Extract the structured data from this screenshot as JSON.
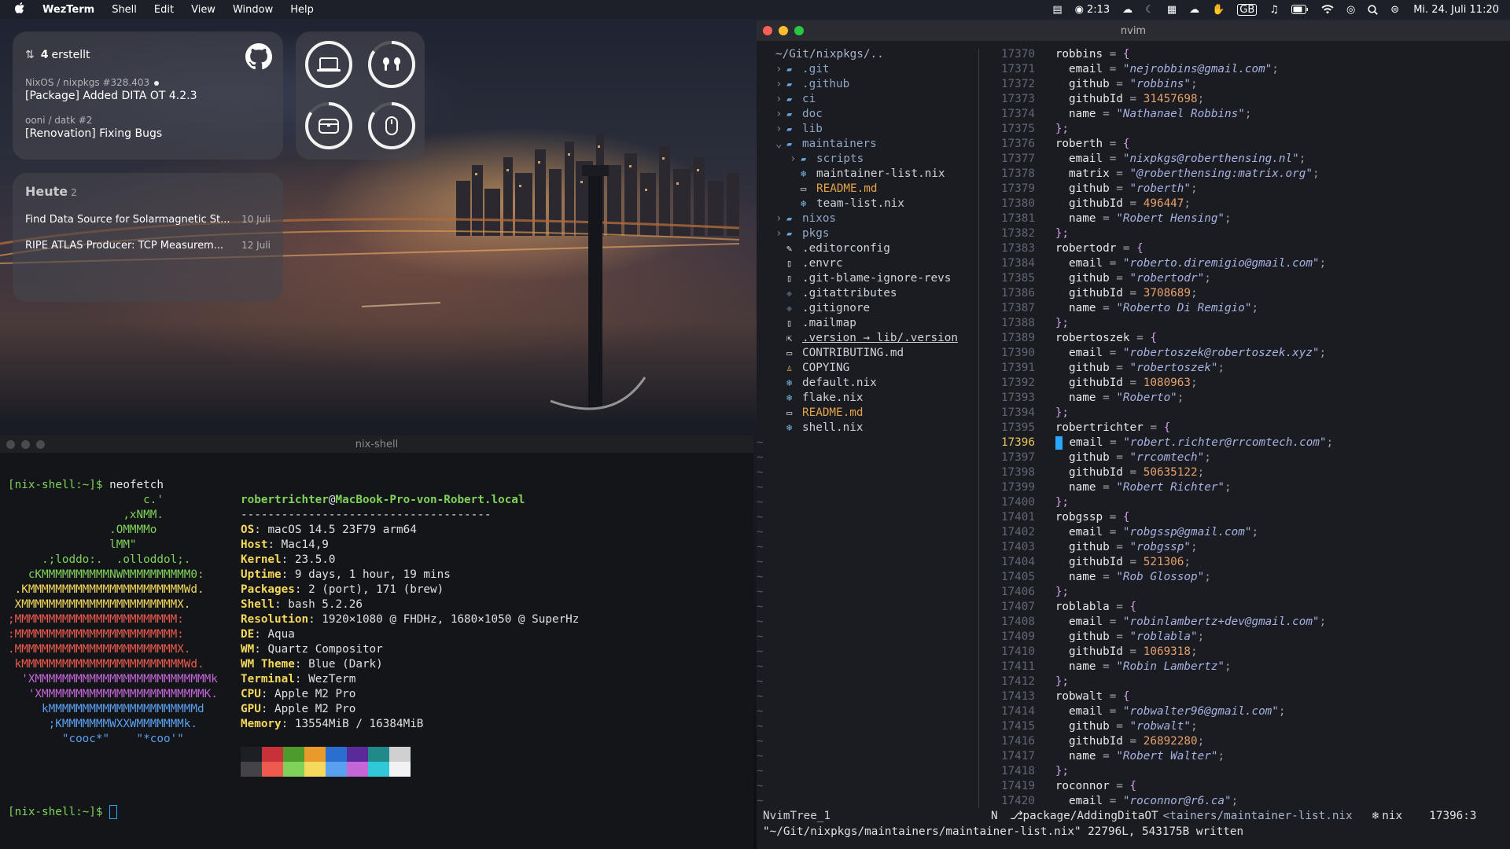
{
  "menubar": {
    "app_name": "WezTerm",
    "menus": [
      "Shell",
      "Edit",
      "View",
      "Window",
      "Help"
    ],
    "timer": "2:13",
    "keyboard": "GB",
    "datetime": "Mi. 24. Juli  11:20"
  },
  "github_widget": {
    "count": "4",
    "label": "erstellt",
    "items": [
      {
        "meta": "NixOS / nixpkgs #328.403",
        "title": "[Package] Added DITA OT 4.2.3",
        "unread": true
      },
      {
        "meta": "ooni / datk #2",
        "title": "[Renovation] Fixing Bugs",
        "unread": false
      }
    ]
  },
  "battery_widget": {
    "devices": [
      {
        "icon": "laptop-icon",
        "level": 1.0
      },
      {
        "icon": "airpods-icon",
        "level": 0.85
      },
      {
        "icon": "airpods-case-icon",
        "level": 0.85
      },
      {
        "icon": "mouse-icon",
        "level": 0.85
      }
    ]
  },
  "today_widget": {
    "title": "Heute",
    "count": "2",
    "items": [
      {
        "text": "Find Data Source for Solarmagnetic St...",
        "date": "10 Juli"
      },
      {
        "text": "RIPE ATLAS Producer: TCP Measurem...",
        "date": "12 Juli"
      }
    ]
  },
  "nixshell": {
    "title": "nix-shell",
    "prompt": "[nix-shell:~]$",
    "command": "neofetch",
    "user_host_user": "robertrichter",
    "user_host_at": "@",
    "user_host_host": "MacBook-Pro-von-Robert.local",
    "separator": "-------------------------------------",
    "art": [
      "                    c.'",
      "                 ,xNMM.",
      "               .OMMMMo",
      "               lMM\"",
      "     .;loddo:.  .olloddol;.",
      "   cKMMMMMMMMMMNWMMMMMMMMMM0:",
      " .KMMMMMMMMMMMMMMMMMMMMMMMWd.",
      " XMMMMMMMMMMMMMMMMMMMMMMMX.",
      ";MMMMMMMMMMMMMMMMMMMMMMMM:",
      ":MMMMMMMMMMMMMMMMMMMMMMMM:",
      ".MMMMMMMMMMMMMMMMMMMMMMMMX.",
      " kMMMMMMMMMMMMMMMMMMMMMMMMWd.",
      "  'XMMMMMMMMMMMMMMMMMMMMMMMMMMk",
      "   'XMMMMMMMMMMMMMMMMMMMMMMMMK.",
      "     kMMMMMMMMMMMMMMMMMMMMMMd",
      "      ;KMMMMMMMWXXWMMMMMMMk.",
      "        \"cooc*\"    \"*coo'\""
    ],
    "art_colors": [
      "#7fd35a",
      "#7fd35a",
      "#7fd35a",
      "#7fd35a",
      "#7fd35a",
      "#7fd35a",
      "#f5d95c",
      "#f5d95c",
      "#ef5a4e",
      "#ef5a4e",
      "#ef5a4e",
      "#ef5a4e",
      "#c466d8",
      "#c466d8",
      "#5aa0f0",
      "#5aa0f0",
      "#5aa0f0"
    ],
    "info": [
      {
        "key": "OS",
        "value": "macOS 14.5 23F79 arm64"
      },
      {
        "key": "Host",
        "value": "Mac14,9"
      },
      {
        "key": "Kernel",
        "value": "23.5.0"
      },
      {
        "key": "Uptime",
        "value": "9 days, 1 hour, 19 mins"
      },
      {
        "key": "Packages",
        "value": "2 (port), 171 (brew)"
      },
      {
        "key": "Shell",
        "value": "bash 5.2.26"
      },
      {
        "key": "Resolution",
        "value": "1920×1080 @ FHDHz, 1680×1050 @ SuperHz"
      },
      {
        "key": "DE",
        "value": "Aqua"
      },
      {
        "key": "WM",
        "value": "Quartz Compositor"
      },
      {
        "key": "WM Theme",
        "value": "Blue (Dark)"
      },
      {
        "key": "Terminal",
        "value": "WezTerm"
      },
      {
        "key": "CPU",
        "value": "Apple M2 Pro"
      },
      {
        "key": "GPU",
        "value": "Apple M2 Pro"
      },
      {
        "key": "Memory",
        "value": "13554MiB / 16384MiB"
      }
    ],
    "palette_top": [
      "#1e1f24",
      "#c8303a",
      "#4f9a2d",
      "#e89a2a",
      "#2a6fd0",
      "#5a2a9a",
      "#208a8a",
      "#d0d0d0"
    ],
    "palette_bottom": [
      "#444448",
      "#ef5a4e",
      "#7fd35a",
      "#f5d95c",
      "#5aa0f0",
      "#c466d8",
      "#30c8d8",
      "#f2f2f2"
    ]
  },
  "nvim": {
    "title": "nvim",
    "tree_root": "~/Git/nixpkgs/..",
    "tree": [
      {
        "depth": 0,
        "chev": "›",
        "icon": "folder-icon",
        "name": ".git",
        "kind": "dir"
      },
      {
        "depth": 0,
        "chev": "›",
        "icon": "folder-icon",
        "name": ".github",
        "kind": "dir"
      },
      {
        "depth": 0,
        "chev": "›",
        "icon": "folder-icon",
        "name": "ci",
        "kind": "dir"
      },
      {
        "depth": 0,
        "chev": "›",
        "icon": "folder-icon",
        "name": "doc",
        "kind": "dir"
      },
      {
        "depth": 0,
        "chev": "›",
        "icon": "folder-icon",
        "name": "lib",
        "kind": "dir"
      },
      {
        "depth": 0,
        "chev": "⌄",
        "icon": "folder-open-icon",
        "name": "maintainers",
        "kind": "dir"
      },
      {
        "depth": 1,
        "chev": "›",
        "icon": "folder-icon",
        "name": "scripts",
        "kind": "dir"
      },
      {
        "depth": 1,
        "chev": "",
        "icon": "nix-icon",
        "name": "maintainer-list.nix",
        "kind": "file"
      },
      {
        "depth": 1,
        "chev": "",
        "icon": "markdown-icon",
        "name": "README.md",
        "kind": "readme"
      },
      {
        "depth": 1,
        "chev": "",
        "icon": "nix-icon",
        "name": "team-list.nix",
        "kind": "file"
      },
      {
        "depth": 0,
        "chev": "›",
        "icon": "folder-icon",
        "name": "nixos",
        "kind": "dir"
      },
      {
        "depth": 0,
        "chev": "›",
        "icon": "folder-icon",
        "name": "pkgs",
        "kind": "dir"
      },
      {
        "depth": 0,
        "chev": "",
        "icon": "config-icon",
        "name": ".editorconfig",
        "kind": "file"
      },
      {
        "depth": 0,
        "chev": "",
        "icon": "file-icon",
        "name": ".envrc",
        "kind": "file"
      },
      {
        "depth": 0,
        "chev": "",
        "icon": "file-icon",
        "name": ".git-blame-ignore-revs",
        "kind": "file"
      },
      {
        "depth": 0,
        "chev": "",
        "icon": "git-icon",
        "name": ".gitattributes",
        "kind": "file"
      },
      {
        "depth": 0,
        "chev": "",
        "icon": "git-icon",
        "name": ".gitignore",
        "kind": "file"
      },
      {
        "depth": 0,
        "chev": "",
        "icon": "file-icon",
        "name": ".mailmap",
        "kind": "file"
      },
      {
        "depth": 0,
        "chev": "",
        "icon": "symlink-icon",
        "name": ".version → lib/.version",
        "kind": "link"
      },
      {
        "depth": 0,
        "chev": "",
        "icon": "markdown-icon",
        "name": "CONTRIBUTING.md",
        "kind": "file"
      },
      {
        "depth": 0,
        "chev": "",
        "icon": "license-icon",
        "name": "COPYING",
        "kind": "file"
      },
      {
        "depth": 0,
        "chev": "",
        "icon": "nix-icon",
        "name": "default.nix",
        "kind": "file"
      },
      {
        "depth": 0,
        "chev": "",
        "icon": "nix-icon",
        "name": "flake.nix",
        "kind": "file"
      },
      {
        "depth": 0,
        "chev": "",
        "icon": "markdown-icon",
        "name": "README.md",
        "kind": "readme"
      },
      {
        "depth": 0,
        "chev": "",
        "icon": "nix-icon",
        "name": "shell.nix",
        "kind": "file"
      }
    ],
    "tilde_rows": 25,
    "current_line": "17396",
    "code": [
      {
        "n": "17370",
        "t": "open",
        "name": "robbins"
      },
      {
        "n": "17371",
        "t": "kv",
        "k": "email",
        "s": "\"nejrobbins@gmail.com\""
      },
      {
        "n": "17372",
        "t": "kv",
        "k": "github",
        "s": "\"robbins\""
      },
      {
        "n": "17373",
        "t": "kvn",
        "k": "githubId",
        "v": "31457698"
      },
      {
        "n": "17374",
        "t": "kv",
        "k": "name",
        "s": "\"Nathanael Robbins\""
      },
      {
        "n": "17375",
        "t": "close"
      },
      {
        "n": "17376",
        "t": "open",
        "name": "roberth"
      },
      {
        "n": "17377",
        "t": "kv",
        "k": "email",
        "s": "\"nixpkgs@roberthensing.nl\""
      },
      {
        "n": "17378",
        "t": "kv",
        "k": "matrix",
        "s": "\"@roberthensing:matrix.org\""
      },
      {
        "n": "17379",
        "t": "kv",
        "k": "github",
        "s": "\"roberth\""
      },
      {
        "n": "17380",
        "t": "kvn",
        "k": "githubId",
        "v": "496447"
      },
      {
        "n": "17381",
        "t": "kv",
        "k": "name",
        "s": "\"Robert Hensing\""
      },
      {
        "n": "17382",
        "t": "close"
      },
      {
        "n": "17383",
        "t": "open",
        "name": "robertodr"
      },
      {
        "n": "17384",
        "t": "kv",
        "k": "email",
        "s": "\"roberto.diremigio@gmail.com\""
      },
      {
        "n": "17385",
        "t": "kv",
        "k": "github",
        "s": "\"robertodr\""
      },
      {
        "n": "17386",
        "t": "kvn",
        "k": "githubId",
        "v": "3708689"
      },
      {
        "n": "17387",
        "t": "kv",
        "k": "name",
        "s": "\"Roberto Di Remigio\""
      },
      {
        "n": "17388",
        "t": "close"
      },
      {
        "n": "17389",
        "t": "open",
        "name": "robertoszek"
      },
      {
        "n": "17390",
        "t": "kv",
        "k": "email",
        "s": "\"robertoszek@robertoszek.xyz\""
      },
      {
        "n": "17391",
        "t": "kv",
        "k": "github",
        "s": "\"robertoszek\""
      },
      {
        "n": "17392",
        "t": "kvn",
        "k": "githubId",
        "v": "1080963"
      },
      {
        "n": "17393",
        "t": "kv",
        "k": "name",
        "s": "\"Roberto\""
      },
      {
        "n": "17394",
        "t": "close"
      },
      {
        "n": "17395",
        "t": "open",
        "name": "robertrichter"
      },
      {
        "n": "17396",
        "t": "kv",
        "k": "email",
        "s": "\"robert.richter@rrcomtech.com\"",
        "cursor": true
      },
      {
        "n": "17397",
        "t": "kv",
        "k": "github",
        "s": "\"rrcomtech\""
      },
      {
        "n": "17398",
        "t": "kvn",
        "k": "githubId",
        "v": "50635122"
      },
      {
        "n": "17399",
        "t": "kv",
        "k": "name",
        "s": "\"Robert Richter\""
      },
      {
        "n": "17400",
        "t": "close"
      },
      {
        "n": "17401",
        "t": "open",
        "name": "robgssp"
      },
      {
        "n": "17402",
        "t": "kv",
        "k": "email",
        "s": "\"robgssp@gmail.com\""
      },
      {
        "n": "17403",
        "t": "kv",
        "k": "github",
        "s": "\"robgssp\""
      },
      {
        "n": "17404",
        "t": "kvn",
        "k": "githubId",
        "v": "521306"
      },
      {
        "n": "17405",
        "t": "kv",
        "k": "name",
        "s": "\"Rob Glossop\""
      },
      {
        "n": "17406",
        "t": "close"
      },
      {
        "n": "17407",
        "t": "open",
        "name": "roblabla"
      },
      {
        "n": "17408",
        "t": "kv",
        "k": "email",
        "s": "\"robinlambertz+dev@gmail.com\""
      },
      {
        "n": "17409",
        "t": "kv",
        "k": "github",
        "s": "\"roblabla\""
      },
      {
        "n": "17410",
        "t": "kvn",
        "k": "githubId",
        "v": "1069318"
      },
      {
        "n": "17411",
        "t": "kv",
        "k": "name",
        "s": "\"Robin Lambertz\""
      },
      {
        "n": "17412",
        "t": "close"
      },
      {
        "n": "17413",
        "t": "open",
        "name": "robwalt"
      },
      {
        "n": "17414",
        "t": "kv",
        "k": "email",
        "s": "\"robwalter96@gmail.com\""
      },
      {
        "n": "17415",
        "t": "kv",
        "k": "github",
        "s": "\"robwalt\""
      },
      {
        "n": "17416",
        "t": "kvn",
        "k": "githubId",
        "v": "26892280"
      },
      {
        "n": "17417",
        "t": "kv",
        "k": "name",
        "s": "\"Robert Walter\""
      },
      {
        "n": "17418",
        "t": "close"
      },
      {
        "n": "17419",
        "t": "open",
        "name": "roconnor"
      },
      {
        "n": "17420",
        "t": "kv",
        "k": "email",
        "s": "\"roconnor@r6.ca\""
      }
    ],
    "status": {
      "buffer": "NvimTree_1",
      "mode": "N",
      "branch": "package/AddingDitaOT",
      "file": "<tainers/maintainer-list.nix",
      "filetype": "nix",
      "position": "17396:3"
    },
    "message": "\"~/Git/nixpkgs/maintainers/maintainer-list.nix\" 22796L, 543175B written"
  },
  "colors": {
    "accent_blue": "#2aa8ff",
    "prompt_green": "#7fd35a",
    "info_yellow": "#f5d95c"
  }
}
